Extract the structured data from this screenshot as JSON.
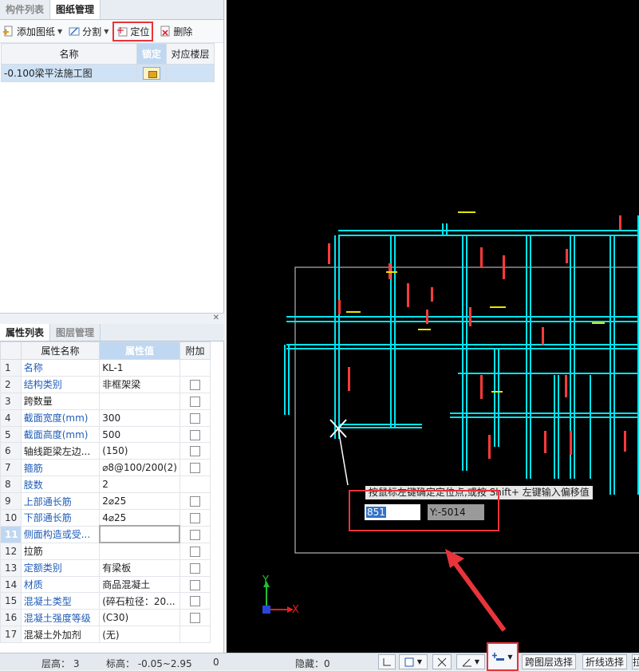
{
  "top_tabs": [
    "构件列表",
    "图纸管理"
  ],
  "toolbar": {
    "add_drawing": "添加图纸",
    "split": "分割",
    "locate": "定位",
    "delete": "删除"
  },
  "drawing_table": {
    "headers": [
      "名称",
      "锁定",
      "对应楼层"
    ],
    "rows": [
      {
        "name": "-0.100梁平法施工图",
        "floor": ""
      }
    ]
  },
  "bottom_tabs": [
    "属性列表",
    "图层管理"
  ],
  "prop_table": {
    "headers": [
      "属性名称",
      "属性值",
      "附加"
    ],
    "rows": [
      {
        "num": "1",
        "name": "名称",
        "value": "KL-1",
        "blue": true,
        "check": false
      },
      {
        "num": "2",
        "name": "结构类别",
        "value": "非框架梁",
        "blue": true,
        "check": true
      },
      {
        "num": "3",
        "name": "跨数量",
        "value": "",
        "blue": false,
        "check": true
      },
      {
        "num": "4",
        "name": "截面宽度(mm)",
        "value": "300",
        "blue": true,
        "check": true
      },
      {
        "num": "5",
        "name": "截面高度(mm)",
        "value": "500",
        "blue": true,
        "check": true
      },
      {
        "num": "6",
        "name": "轴线距梁左边...",
        "value": "(150)",
        "blue": false,
        "check": true
      },
      {
        "num": "7",
        "name": "箍筋",
        "value": "⌀8@100/200(2)",
        "blue": true,
        "check": true
      },
      {
        "num": "8",
        "name": "肢数",
        "value": "2",
        "blue": true,
        "check": false
      },
      {
        "num": "9",
        "name": "上部通长筋",
        "value": "2⌀25",
        "blue": true,
        "check": true
      },
      {
        "num": "10",
        "name": "下部通长筋",
        "value": "4⌀25",
        "blue": true,
        "check": true
      },
      {
        "num": "11",
        "name": "侧面构造或受...",
        "value": "",
        "blue": true,
        "check": true,
        "current": true
      },
      {
        "num": "12",
        "name": "拉筋",
        "value": "",
        "blue": false,
        "check": true
      },
      {
        "num": "13",
        "name": "定额类别",
        "value": "有梁板",
        "blue": true,
        "check": true
      },
      {
        "num": "14",
        "name": "材质",
        "value": "商品混凝土",
        "blue": true,
        "check": true
      },
      {
        "num": "15",
        "name": "混凝土类型",
        "value": "(碎石粒径：20...",
        "blue": true,
        "check": true
      },
      {
        "num": "16",
        "name": "混凝土强度等级",
        "value": "(C30)",
        "blue": true,
        "check": true
      },
      {
        "num": "17",
        "name": "混凝土外加剂",
        "value": "(无)",
        "blue": false,
        "check": false
      }
    ]
  },
  "canvas": {
    "tooltip": "按鼠标左键确定定位点,或按 Shift+ 左键输入偏移值",
    "x_value": "851",
    "y_value": "Y:-5014",
    "axis_y": "Y",
    "axis_x": "X"
  },
  "status": {
    "floor_height": "层高：  3",
    "elevation": "标高：  -0.05~2.95",
    "zero": "0",
    "hidden": "隐藏：0",
    "cross_layer": "跨图层选择",
    "polyline": "折线选择",
    "last": "拉"
  },
  "colors": {
    "accent_red": "#e8343a",
    "beam_cyan": "#00e5f0",
    "label_red": "#ff3b3b"
  }
}
